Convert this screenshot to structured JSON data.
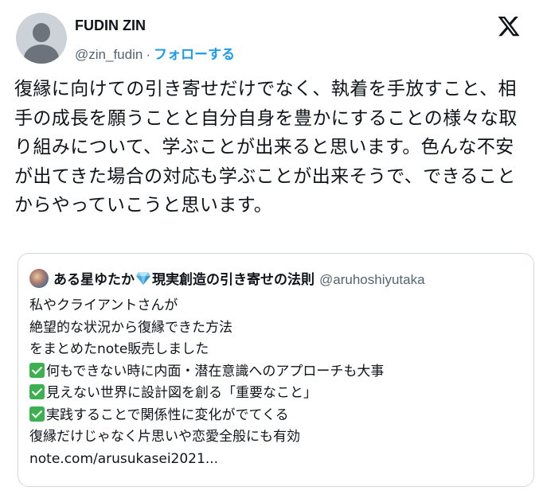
{
  "author": {
    "name": "FUDIN ZIN",
    "handle": "@zin_fudin",
    "separator": "·",
    "follow_label": "フォローする"
  },
  "tweet": {
    "text": "復縁に向けての引き寄せだけでなく、執着を手放すこと、相手の成長を願うことと自分自身を豊かにすることの様々な取り組みについて、学ぶことが出来ると思います。色んな不安が出てきた場合の対応も学ぶことが出来そうで、できることからやっていこうと思います。"
  },
  "quoted": {
    "name_part1": "ある星ゆたか",
    "name_part2": "現実創造の引き寄せの法則",
    "handle": "@aruhoshiyutaka",
    "lines": [
      "私やクライアントさんが",
      "絶望的な状況から復縁できた方法",
      "をまとめたnote販売しました"
    ],
    "checks": [
      "何もできない時に内面・潜在意識へのアプローチも大事",
      "見えない世界に設計図を創る「重要なこと」",
      "実践することで関係性に変化がでてくる"
    ],
    "closing": "復縁だけじゃなく片思いや恋愛全般にも有効",
    "link": "note.com/arusukasei2021..."
  },
  "colors": {
    "follow": "#1d9bf0",
    "secondary_text": "#536471",
    "check_green": "#3db14f",
    "border": "#cfd9de"
  },
  "icons": {
    "close": "x-logo-icon",
    "avatar": "default-avatar-icon",
    "gem": "gem-icon",
    "check": "check-mark-icon"
  }
}
